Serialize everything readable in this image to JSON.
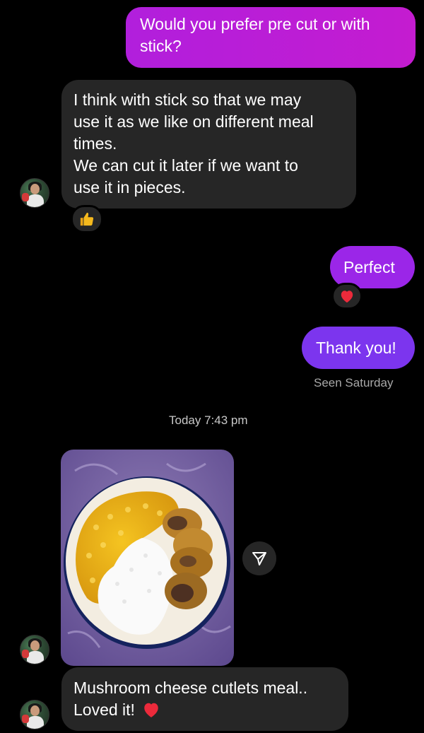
{
  "conversation": {
    "messages": [
      {
        "sender": "me",
        "text": "Would you prefer pre cut or with stick?",
        "lines": [
          "Would you prefer pre cut or with",
          "stick?"
        ]
      },
      {
        "sender": "them",
        "lines": [
          "I think with stick so that we may",
          "use it as we like on different meal",
          "times.",
          "We can cut it later if we want to",
          "use it in pieces."
        ],
        "reaction": "thumbs-up-icon"
      },
      {
        "sender": "me",
        "text": "Perfect",
        "reaction": "heart-icon"
      },
      {
        "sender": "me",
        "text": "Thank you!"
      },
      {
        "sender": "them",
        "type": "photo",
        "image": "plate of yellow dal, white rice and mushroom cheese cutlets on purple floral cloth"
      },
      {
        "sender": "them",
        "lines": [
          "Mushroom cheese cutlets meal..",
          "Loved it!"
        ],
        "emoji": "heart-icon"
      }
    ],
    "seen_status": "Seen Saturday",
    "timestamp": "Today 7:43 pm"
  },
  "colors": {
    "outgoing_1": "#c41cd0",
    "outgoing_2": "#9b26e8",
    "outgoing_3": "#7c35ee",
    "incoming": "#262626",
    "background": "#000000"
  }
}
